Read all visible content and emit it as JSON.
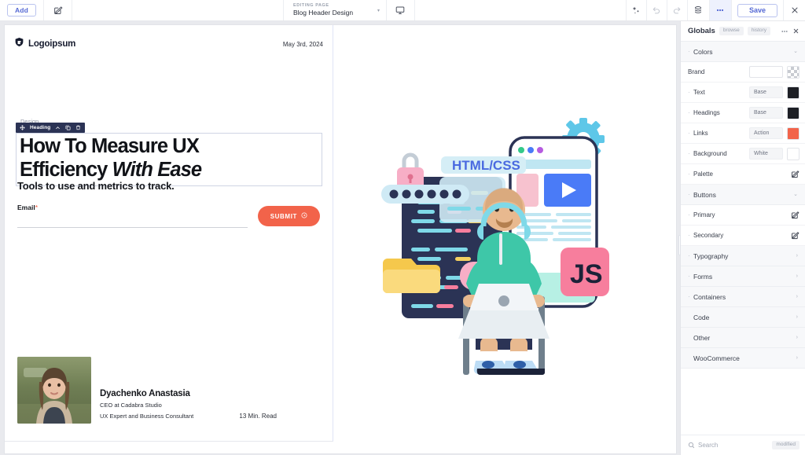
{
  "topbar": {
    "add_label": "Add",
    "edit_icon": "pencil-square-icon",
    "editing_label": "EDITING PAGE",
    "page_name": "Blog Header Design",
    "device_icon": "desktop-icon",
    "magic_icon": "sparkle-icon",
    "undo_icon": "undo-icon",
    "redo_icon": "redo-icon",
    "layers_icon": "layers-icon",
    "more_icon": "more-dots-icon",
    "save_label": "Save",
    "close_icon": "close-icon"
  },
  "article": {
    "logo_text": "Logoipsum",
    "date": "May 3rd, 2024",
    "ghost_label": "Design",
    "selection": {
      "label": "Heading",
      "move_icon": "move-icon",
      "up_icon": "chevron-up-icon",
      "duplicate_icon": "duplicate-icon",
      "delete_icon": "trash-icon"
    },
    "headline_part1": "How To Measure UX",
    "headline_part2": "Efficiency ",
    "headline_italic": "With Ease",
    "subline": "Tools to use and metrics to track.",
    "form": {
      "email_label": "Email",
      "required_mark": "*",
      "email_value": "",
      "submit_label": "SUBMIT",
      "submit_icon": "arrow-circle-icon"
    },
    "author": {
      "avatar_alt": "author-photo",
      "name": "Dyachenko Anastasia",
      "role_line1": "CEO at Cadabra Studio",
      "role_line2": "UX Expert and Business Consultant",
      "read_time": "13 Min. Read"
    }
  },
  "illustration": {
    "alt": "developer-working-illustration",
    "code_label": "HTML/CSS",
    "js_label": "JS"
  },
  "panel": {
    "title": "Globals",
    "chips": [
      "browse",
      "history"
    ],
    "more_icon": "more-dots-icon",
    "close_icon": "close-icon",
    "sections": [
      {
        "name": "Colors",
        "dot": true,
        "state": "expanded",
        "chevron": "chevron-down-icon",
        "rows": [
          {
            "label": "Brand",
            "dot": false,
            "value": "",
            "swatch": "transparent",
            "control": "input-swatch"
          },
          {
            "label": "Text",
            "dot": true,
            "value": "Base",
            "swatch": "#1d1f25",
            "control": "input-swatch"
          },
          {
            "label": "Headings",
            "dot": true,
            "value": "Base",
            "swatch": "#1d1f25",
            "control": "input-swatch"
          },
          {
            "label": "Links",
            "dot": true,
            "value": "Action",
            "swatch": "#f2634a",
            "control": "input-swatch"
          },
          {
            "label": "Background",
            "dot": true,
            "value": "White",
            "swatch": "#ffffff",
            "control": "input-swatch"
          },
          {
            "label": "Palette",
            "dot": true,
            "value": "",
            "control": "edit"
          }
        ]
      },
      {
        "name": "Buttons",
        "dot": true,
        "state": "expanded",
        "chevron": "chevron-down-icon",
        "rows": [
          {
            "label": "Primary",
            "dot": true,
            "control": "edit"
          },
          {
            "label": "Secondary",
            "dot": true,
            "control": "edit"
          }
        ]
      },
      {
        "name": "Typography",
        "dot": true,
        "state": "collapsed",
        "chevron": "chevron-right-icon",
        "rows": []
      },
      {
        "name": "Forms",
        "dot": true,
        "state": "collapsed",
        "chevron": "chevron-right-icon",
        "rows": []
      },
      {
        "name": "Containers",
        "dot": true,
        "state": "collapsed",
        "chevron": "chevron-right-icon",
        "rows": []
      },
      {
        "name": "Code",
        "dot": false,
        "state": "collapsed",
        "chevron": "chevron-right-icon",
        "rows": []
      },
      {
        "name": "Other",
        "dot": false,
        "state": "collapsed",
        "chevron": "chevron-right-icon",
        "rows": []
      },
      {
        "name": "WooCommerce",
        "dot": false,
        "state": "collapsed",
        "chevron": "chevron-right-icon",
        "rows": []
      }
    ],
    "footer": {
      "search_icon": "search-icon",
      "search_placeholder": "Search",
      "modified_chip": "modified"
    }
  },
  "colors": {
    "accent_blue": "#5468d4",
    "accent_coral": "#f2634a",
    "selection_navy": "#2b3355",
    "canvas_gray": "#e9eaee"
  }
}
